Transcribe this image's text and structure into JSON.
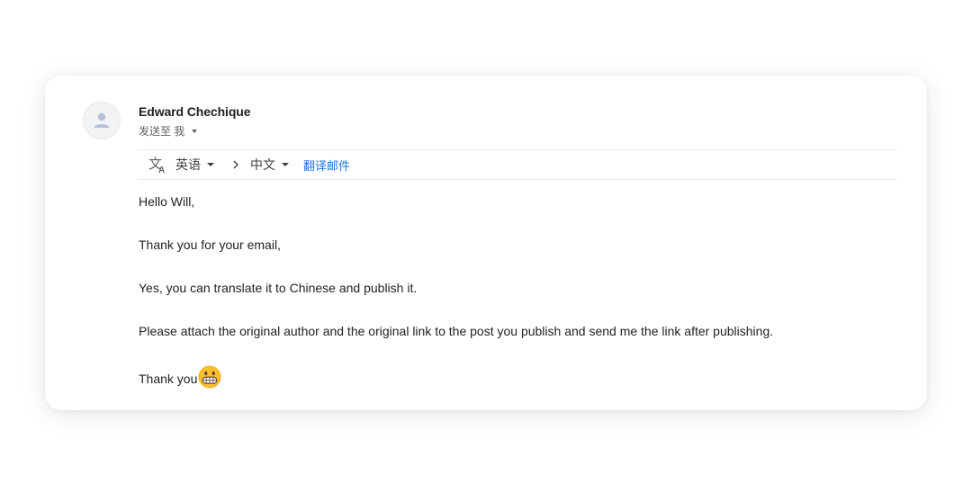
{
  "email": {
    "sender_name": "Edward Chechique",
    "recipient_line": "发送至 我",
    "icons": {
      "avatar": "person-icon",
      "translate": "translate-icon",
      "arrow": "chevron-right-icon",
      "emoji": "grinning-face-emoji"
    },
    "translate_bar": {
      "source_lang": "英语",
      "target_lang": "中文",
      "translate_link": "翻译邮件",
      "link_color": "#1a73e8"
    },
    "body": {
      "lines": [
        "Hello Will,",
        "Thank you for your email,",
        "Yes, you can translate it to Chinese and publish it.",
        "Please attach the original author and the original link to the post you publish and send me the link after publishing.",
        "Thank you"
      ]
    }
  }
}
